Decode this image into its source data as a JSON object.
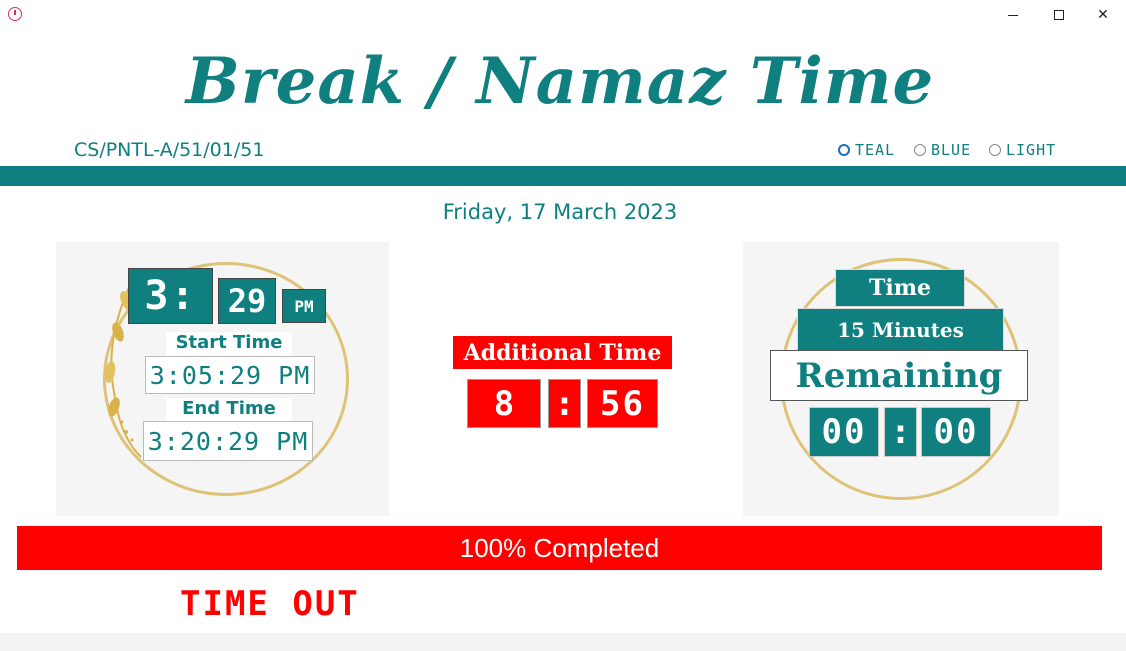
{
  "window": {
    "icon": "clock-icon",
    "minimize_glyph": "",
    "maximize_glyph": "",
    "close_glyph": "✕"
  },
  "header": {
    "title": "Break / Namaz Time",
    "code": "CS/PNTL-A/51/01/51"
  },
  "themes": {
    "options": [
      {
        "label": "TEAL",
        "selected": true
      },
      {
        "label": "BLUE",
        "selected": false
      },
      {
        "label": "LIGHT",
        "selected": false
      }
    ]
  },
  "date": "Friday, 17 March 2023",
  "clock": {
    "hour": "3:",
    "minute": "29",
    "ampm": "PM",
    "start_label": "Start Time",
    "start_value": "3:05:29 PM",
    "end_label": "End Time",
    "end_value": "3:20:29 PM"
  },
  "additional": {
    "label": "Additional Time",
    "minutes": "8",
    "separator": ":",
    "seconds": "56"
  },
  "remaining": {
    "time_label": "Time",
    "duration_label": "15 Minutes",
    "remaining_label": "Remaining",
    "minutes": "00",
    "separator": ":",
    "seconds": "00"
  },
  "progress": {
    "percent": 100,
    "text": "100% Completed"
  },
  "status": "TIME OUT",
  "colors": {
    "teal": "#0f7f7f",
    "red": "#ff0000",
    "gold": "#dec276"
  }
}
